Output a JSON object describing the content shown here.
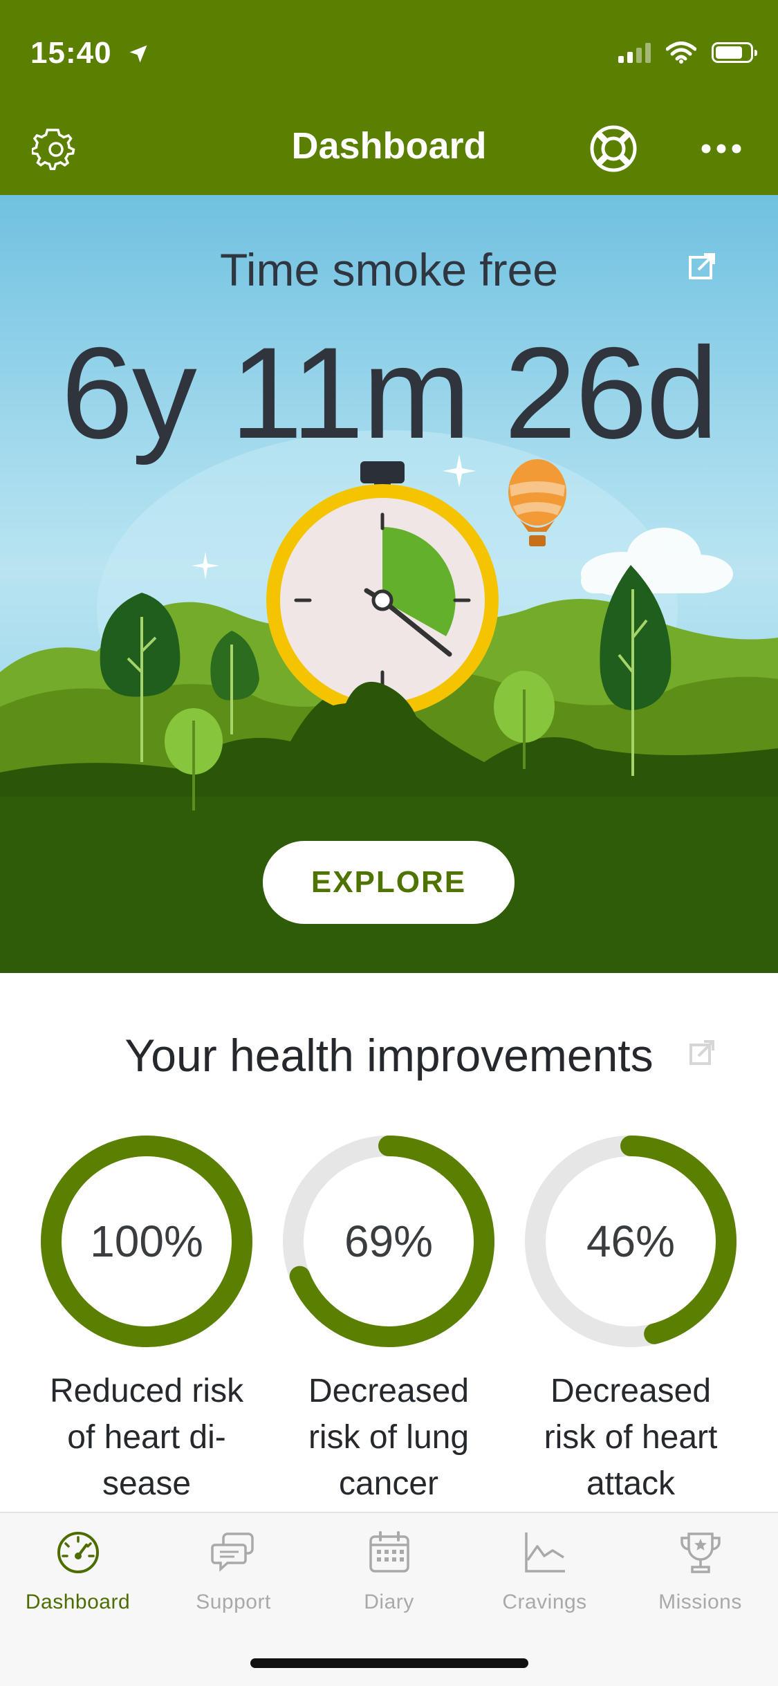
{
  "status_bar": {
    "time": "15:40",
    "location_icon": "location-arrow-icon",
    "signal_icon": "cellular-signal-icon",
    "wifi_icon": "wifi-icon",
    "battery_icon": "battery-icon"
  },
  "nav": {
    "title": "Dashboard",
    "left_icon": "gear-icon",
    "help_icon": "lifebuoy-icon",
    "more_icon": "more-dots-icon"
  },
  "hero": {
    "title": "Time smoke free",
    "value": "6y 11m 26d",
    "button": "EXPLORE",
    "share_icon": "share-icon",
    "timer_progress": 0.36
  },
  "health": {
    "title": "Your health improvements",
    "share_icon": "share-icon",
    "items": [
      {
        "percent_text": "100%",
        "value": 1.0,
        "label_lines": [
          "Reduced risk",
          "of heart di-",
          "sease"
        ]
      },
      {
        "percent_text": "69%",
        "value": 0.69,
        "label_lines": [
          "Decreased",
          "risk of lung",
          "cancer"
        ]
      },
      {
        "percent_text": "46%",
        "value": 0.46,
        "label_lines": [
          "Decreased",
          "risk of heart",
          "attack"
        ]
      }
    ]
  },
  "tabs": [
    {
      "label": "Dashboard",
      "icon": "speedometer-icon",
      "active": true
    },
    {
      "label": "Support",
      "icon": "chat-bubbles-icon",
      "active": false
    },
    {
      "label": "Diary",
      "icon": "calendar-icon",
      "active": false
    },
    {
      "label": "Cravings",
      "icon": "line-chart-icon",
      "active": false
    },
    {
      "label": "Missions",
      "icon": "trophy-icon",
      "active": false
    }
  ],
  "colors": {
    "brand_green": "#5a7f01",
    "ring_green": "#5a7f01",
    "ring_track": "#e6e6e6",
    "tab_active": "#4d6d00",
    "tab_inactive": "#a9a9a9"
  }
}
